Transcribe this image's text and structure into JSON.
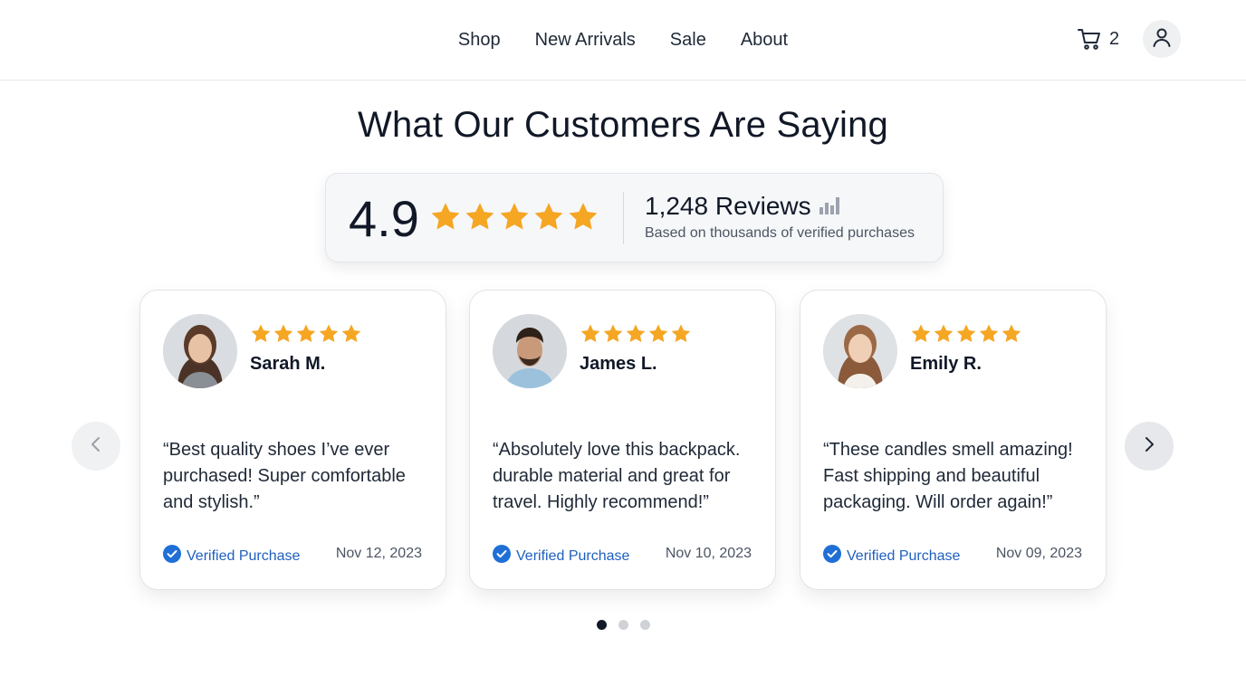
{
  "nav": {
    "links": [
      "Shop",
      "New Arrivals",
      "Sale",
      "About"
    ],
    "cart_count": "2",
    "cart_icon": "cart-icon",
    "account_icon": "user-icon"
  },
  "section": {
    "title": "What Our Customers Are Saying"
  },
  "summary": {
    "average": "4.9",
    "rating_value": 4.9,
    "rating_max": 5,
    "reviews_count": "1,248 Reviews",
    "subtitle": "Based on thousands of verified purchases",
    "chart_icon": "bar-chart-icon"
  },
  "reviews": [
    {
      "name": "Sarah M.",
      "rating": 5,
      "quote": "“Best quality shoes I’ve ever purchased! Super comfortable and stylish.”",
      "verified": "Verified Purchase",
      "date": "Nov 12, 2023"
    },
    {
      "name": "James L.",
      "rating": 5,
      "quote": "“Absolutely love this backpack. durable material and great for travel. Highly recommend!”",
      "verified": "Verified Purchase",
      "date": "Nov 10, 2023"
    },
    {
      "name": "Emily R.",
      "rating": 5,
      "quote": "“These candles smell amazing! Fast shipping and beautiful packaging. Will order again!”",
      "verified": "Verified Purchase",
      "date": "Nov 09, 2023"
    }
  ],
  "carousel": {
    "page_count": 3,
    "active_page": 1,
    "prev_icon": "chevron-left-icon",
    "next_icon": "chevron-right-icon"
  },
  "colors": {
    "star": "#F5A623",
    "verified": "#1F5FBF",
    "text": "#111827"
  }
}
